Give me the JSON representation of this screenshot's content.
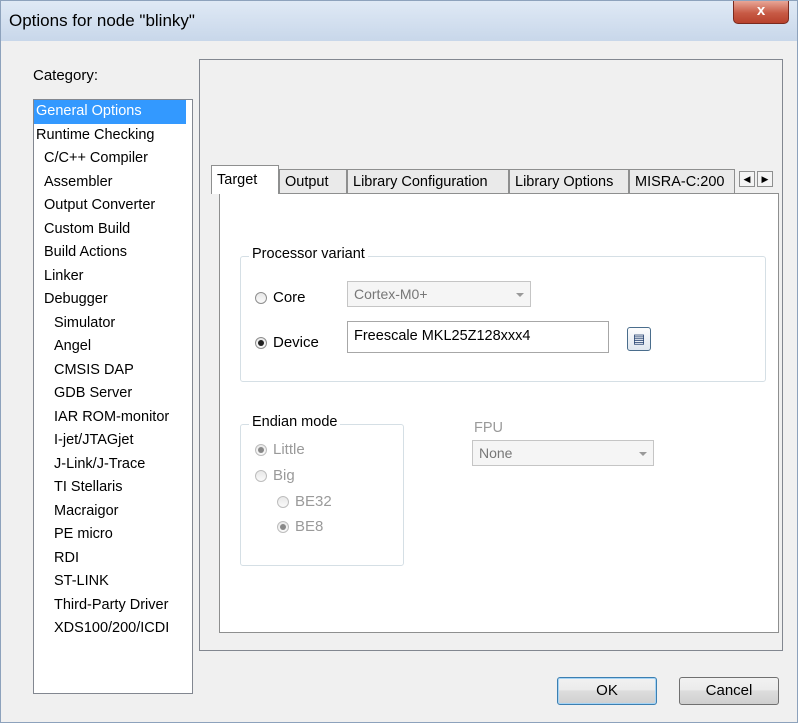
{
  "window": {
    "title": "Options for node \"blinky\"",
    "close_label": "x"
  },
  "category": {
    "label": "Category:",
    "items": [
      {
        "label": "General Options",
        "level": 0,
        "selected": true
      },
      {
        "label": "Runtime Checking",
        "level": 0
      },
      {
        "label": "C/C++ Compiler",
        "level": 1
      },
      {
        "label": "Assembler",
        "level": 1
      },
      {
        "label": "Output Converter",
        "level": 1
      },
      {
        "label": "Custom Build",
        "level": 1
      },
      {
        "label": "Build Actions",
        "level": 1
      },
      {
        "label": "Linker",
        "level": 1
      },
      {
        "label": "Debugger",
        "level": 1
      },
      {
        "label": "Simulator",
        "level": 2
      },
      {
        "label": "Angel",
        "level": 2
      },
      {
        "label": "CMSIS DAP",
        "level": 2
      },
      {
        "label": "GDB Server",
        "level": 2
      },
      {
        "label": "IAR ROM-monitor",
        "level": 2
      },
      {
        "label": "I-jet/JTAGjet",
        "level": 2
      },
      {
        "label": "J-Link/J-Trace",
        "level": 2
      },
      {
        "label": "TI Stellaris",
        "level": 2
      },
      {
        "label": "Macraigor",
        "level": 2
      },
      {
        "label": "PE micro",
        "level": 2
      },
      {
        "label": "RDI",
        "level": 2
      },
      {
        "label": "ST-LINK",
        "level": 2
      },
      {
        "label": "Third-Party Driver",
        "level": 2
      },
      {
        "label": "XDS100/200/ICDI",
        "level": 2
      }
    ]
  },
  "tabs": [
    "Target",
    "Output",
    "Library Configuration",
    "Library Options",
    "MISRA-C:200"
  ],
  "tab_scroll": {
    "left_icon": "scroll-left-icon",
    "right_icon": "scroll-right-icon"
  },
  "processor": {
    "group_title": "Processor variant",
    "core_label": "Core",
    "core_value": "Cortex-M0+",
    "device_label": "Device",
    "device_value": "Freescale MKL25Z128xxx4",
    "browse_icon": "device-browse-icon"
  },
  "endian": {
    "group_title": "Endian mode",
    "little": "Little",
    "big": "Big",
    "be32": "BE32",
    "be8": "BE8"
  },
  "fpu": {
    "label": "FPU",
    "value": "None"
  },
  "buttons": {
    "ok": "OK",
    "cancel": "Cancel"
  },
  "colors": {
    "selection": "#3399ff",
    "close_button": "#c75a45"
  }
}
